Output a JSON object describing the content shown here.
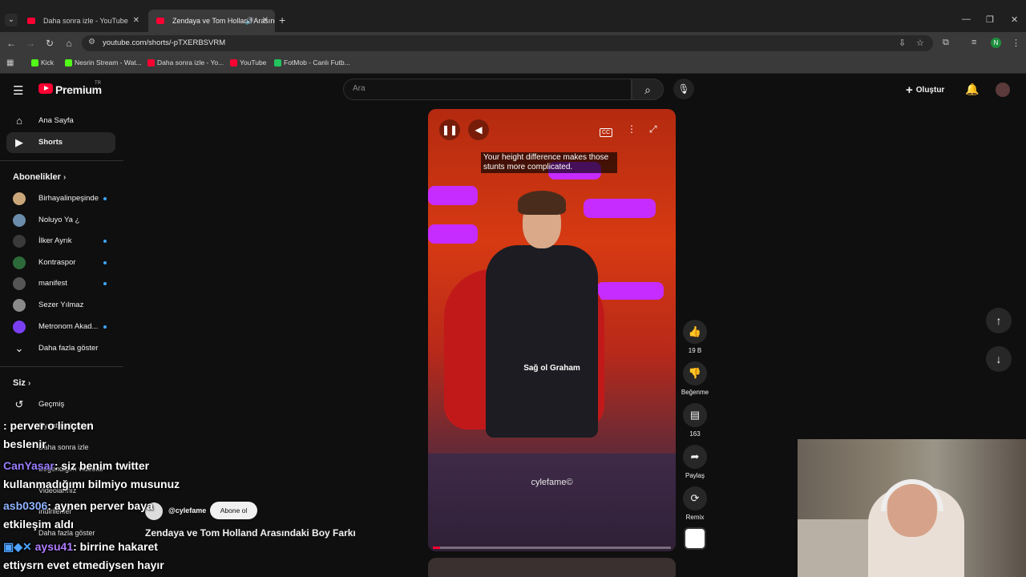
{
  "browser": {
    "tabs": [
      {
        "title": "Daha sonra izle - YouTube"
      },
      {
        "title": "Zendaya ve Tom Holland Arasındaki Boy Farkı"
      }
    ],
    "url": "youtube.com/shorts/-pTXERBSVRM",
    "profile_initial": "N",
    "bookmarks": [
      {
        "label": "Kick",
        "color": "#53fc18"
      },
      {
        "label": "Nesrin Stream - Wat...",
        "color": "#53fc18"
      },
      {
        "label": "Daha sonra izle - Yo...",
        "color": "#ff0033"
      },
      {
        "label": "YouTube",
        "color": "#ff0033"
      },
      {
        "label": "FotMob - Canlı Futb...",
        "color": "#22c55e"
      }
    ]
  },
  "header": {
    "brand": "Premium",
    "brand_sup": "TR",
    "search_placeholder": "Ara",
    "create_label": "Oluştur"
  },
  "sidebar": {
    "main": [
      {
        "label": "Ana Sayfa",
        "icon": "home-icon"
      },
      {
        "label": "Shorts",
        "icon": "shorts-icon"
      }
    ],
    "subs_heading": "Abonelikler",
    "subscriptions": [
      {
        "label": "Birhayalinpeşinde",
        "color": "#caa77a"
      },
      {
        "label": "Noluyo Ya ¿",
        "color": "#6b8caa"
      },
      {
        "label": "İlker Ayrık",
        "color": "#3a3a3a"
      },
      {
        "label": "Kontraspor",
        "color": "#2d6a3a"
      },
      {
        "label": "manifest",
        "color": "#555555"
      },
      {
        "label": "Sezer Yılmaz",
        "color": "#8a8a8a"
      },
      {
        "label": "Metronom Akad...",
        "color": "#7b3ff2"
      }
    ],
    "show_more": "Daha fazla göster",
    "you_heading": "Siz",
    "you_items": [
      {
        "label": "Geçmiş",
        "icon": "history-icon"
      },
      {
        "label": "Oynatma listeleri"
      },
      {
        "label": "Daha sonra izle"
      },
      {
        "label": "Beğendiğim videolar"
      },
      {
        "label": "Videolarınız"
      },
      {
        "label": "İndirilenler"
      },
      {
        "label": "Daha fazla göster"
      }
    ]
  },
  "short": {
    "caption_overlay": "Your height difference makes those stunts more complicated.",
    "subtitle": "Sağ ol Graham",
    "watermark": "cylefame©",
    "channel": "@cylefame",
    "subscribe_label": "Abone ol",
    "title": "Zendaya ve Tom Holland Arasındaki Boy Farkı",
    "progress": 0.03
  },
  "actions": {
    "likes": "19 B",
    "dislike": "Beğenme",
    "comments": "163",
    "share": "Paylaş",
    "remix": "Remix"
  },
  "chat": [
    {
      "user": "",
      "msg": ": perver o linçten"
    },
    {
      "user": "",
      "msg": "beslenir"
    },
    {
      "user": "CanYasar",
      "msg": ": siz benim twitter"
    },
    {
      "user": "",
      "msg": "kullanmadığımı bilmiyo musunuz"
    },
    {
      "user": "asb0306",
      "msg": ": aynen perver baya"
    },
    {
      "user": "",
      "msg": "etkileşim aldı"
    },
    {
      "user": "aysu41",
      "msg": ": birrine hakaret"
    },
    {
      "user": "",
      "msg": "ettiysrn evet etmediysen hayır"
    }
  ]
}
